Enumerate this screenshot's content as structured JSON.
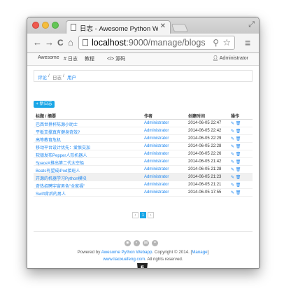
{
  "browser": {
    "tab_title": "日志 - Awesome Python Web",
    "tab_close": "✕",
    "url_host": "localhost",
    "url_port_path": ":9000/manage/blogs",
    "back": "←",
    "forward": "→",
    "reload": "C",
    "home": "⌂",
    "zoom": "⚲",
    "star": "☆",
    "menu": "≡",
    "fullscreen": "⤢"
  },
  "appbar": {
    "brand": "Awesome",
    "nav": [
      "# 日志",
      "教程",
      "</> 源码"
    ],
    "user": "Administrator"
  },
  "breadcrumb": {
    "items": [
      "评论",
      "日志",
      "用户"
    ],
    "sep": "/"
  },
  "new_button": "+ 新日志",
  "table": {
    "headers": [
      "标题 / 摘要",
      "作者",
      "创建时间",
      "操作"
    ],
    "rows": [
      {
        "title": "巴西世界杯陈源小助士",
        "author": "Administrator",
        "date": "2014-06-05 22:47",
        "ops": "✎ 🗑"
      },
      {
        "title": "平板支撑真有健身奇效?",
        "author": "Administrator",
        "date": "2014-06-05 22:42",
        "ops": "✎ 🗑"
      },
      {
        "title": "高等教育危机",
        "author": "Administrator",
        "date": "2014-06-05 22:29",
        "ops": "✎ 🗑"
      },
      {
        "title": "移动平台设计优先：爱恨交加",
        "author": "Administrator",
        "date": "2014-06-05 22:28",
        "ops": "✎ 🗑"
      },
      {
        "title": "软银发布Pepper人形机器人",
        "author": "Administrator",
        "date": "2014-06-05 22:26",
        "ops": "✎ 🗑"
      },
      {
        "title": "SpaceX推出第二代太空船",
        "author": "Administrator",
        "date": "2014-06-05 21:42",
        "ops": "✎ 🗑"
      },
      {
        "title": "Beats有望成iPod接班人",
        "author": "Administrator",
        "date": "2014-06-05 21:28",
        "ops": "✎ 🗑"
      },
      {
        "title": "开源的机器学习Python模块",
        "author": "Administrator",
        "date": "2014-06-05 21:23",
        "ops": "✎ 🗑"
      },
      {
        "title": "奇热招聘宇宙男色\"全家福\"",
        "author": "Administrator",
        "date": "2014-06-05 21:21",
        "ops": "✎ 🗑"
      },
      {
        "title": "Swift背后的男人",
        "author": "Administrator",
        "date": "2014-06-05 17:55",
        "ops": "✎ 🗑"
      }
    ]
  },
  "pagination": {
    "prev": "‹",
    "current": "1",
    "next": "›"
  },
  "footer": {
    "social": [
      "◉",
      "◐",
      "▤",
      "✦"
    ],
    "powered_prefix": "Powered by ",
    "powered_link": "Awesome Python Webapp",
    "powered_mid": ". Copyright © 2014. [",
    "manage": "Manage",
    "powered_suffix": "]",
    "site": "www.liaoxuefeng.com",
    "rights": ". All rights reserved.",
    "html5": "5"
  },
  "colors": {
    "accent": "#1aa6e6",
    "link": "#1e87f0"
  }
}
